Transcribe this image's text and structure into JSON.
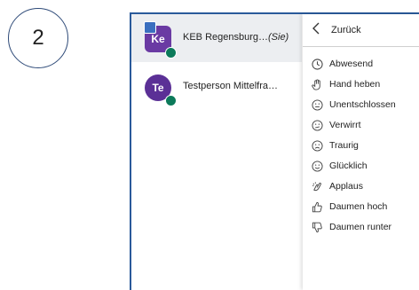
{
  "step": {
    "number": "2"
  },
  "users": [
    {
      "initials": "Ke",
      "name": "KEB Regensburg…",
      "you_label": "(Sie)",
      "active": true
    },
    {
      "initials": "Te",
      "name": "Testperson Mittelfra…",
      "you_label": "",
      "active": false
    }
  ],
  "menu": {
    "back_label": "Zurück",
    "items": [
      {
        "label": "Abwesend",
        "icon": "clock-icon"
      },
      {
        "label": "Hand heben",
        "icon": "hand-icon"
      },
      {
        "label": "Unentschlossen",
        "icon": "undecided-face-icon"
      },
      {
        "label": "Verwirrt",
        "icon": "confused-face-icon"
      },
      {
        "label": "Traurig",
        "icon": "sad-face-icon"
      },
      {
        "label": "Glücklich",
        "icon": "happy-face-icon"
      },
      {
        "label": "Applaus",
        "icon": "clapping-icon"
      },
      {
        "label": "Daumen hoch",
        "icon": "thumbs-up-icon"
      },
      {
        "label": "Daumen runter",
        "icon": "thumbs-down-icon"
      }
    ]
  },
  "colors": {
    "frame_border": "#2a5a9a",
    "avatar": "#6a3aa3",
    "presence": "#0c7a5a"
  }
}
